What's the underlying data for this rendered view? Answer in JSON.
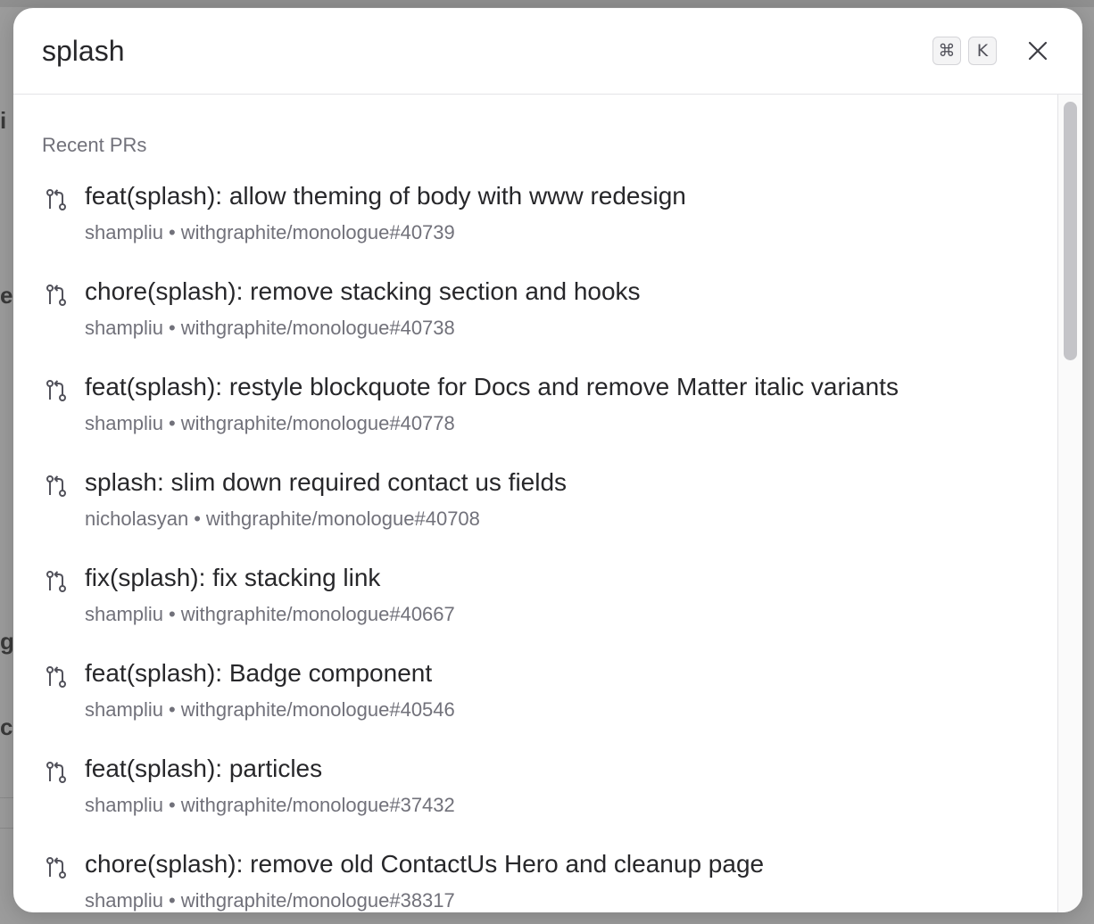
{
  "search": {
    "value": "splash",
    "shortcut_modifier": "⌘",
    "shortcut_key": "K"
  },
  "results": {
    "section_label": "Recent PRs",
    "items": [
      {
        "title": "feat(splash): allow theming of body with www redesign",
        "author": "shampliu",
        "repo_ref": "withgraphite/monologue#40739"
      },
      {
        "title": "chore(splash): remove stacking section and hooks",
        "author": "shampliu",
        "repo_ref": "withgraphite/monologue#40738"
      },
      {
        "title": "feat(splash): restyle blockquote for Docs and remove Matter italic variants",
        "author": "shampliu",
        "repo_ref": "withgraphite/monologue#40778"
      },
      {
        "title": "splash: slim down required contact us fields",
        "author": "nicholasyan",
        "repo_ref": "withgraphite/monologue#40708"
      },
      {
        "title": "fix(splash): fix stacking link",
        "author": "shampliu",
        "repo_ref": "withgraphite/monologue#40667"
      },
      {
        "title": "feat(splash): Badge component",
        "author": "shampliu",
        "repo_ref": "withgraphite/monologue#40546"
      },
      {
        "title": "feat(splash): particles",
        "author": "shampliu",
        "repo_ref": "withgraphite/monologue#37432"
      },
      {
        "title": "chore(splash): remove old ContactUs Hero and cleanup page",
        "author": "shampliu",
        "repo_ref": "withgraphite/monologue#38317"
      }
    ],
    "separator": "•"
  },
  "icons": {
    "item_icon": "git-pull-request-icon",
    "close": "close-icon"
  },
  "colors": {
    "title_text": "#27272a",
    "muted_text": "#71717a",
    "backdrop": "#9c9c9c"
  }
}
